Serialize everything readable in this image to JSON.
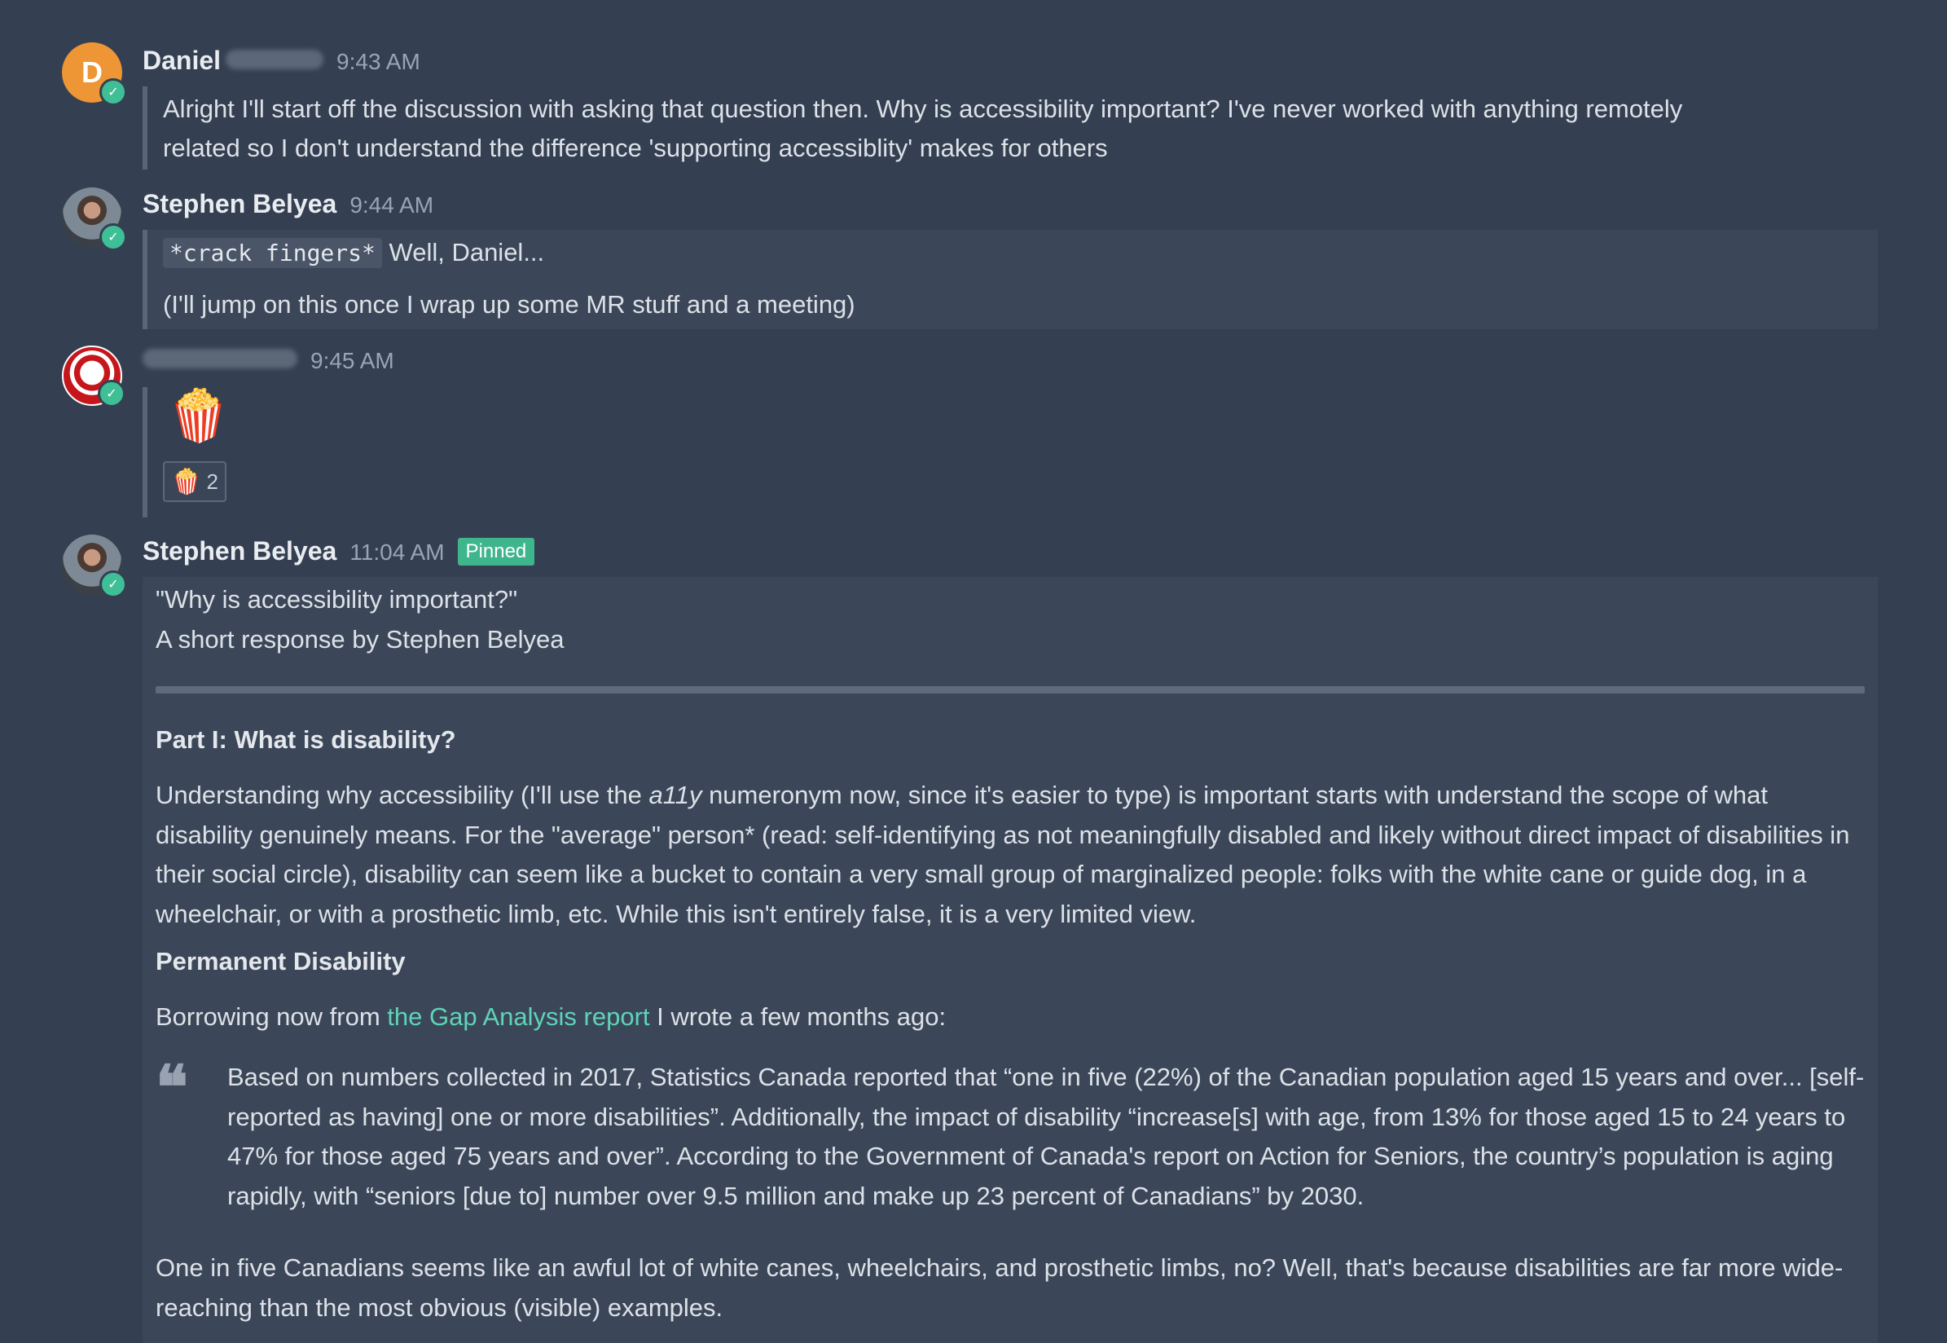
{
  "messages": [
    {
      "author": "Daniel",
      "avatar_initial": "D",
      "time": "9:43 AM",
      "lines": [
        "Alright I'll start off the discussion with asking that question then. Why is accessibility important? I've never worked with anything remotely",
        "related so I don't understand the difference 'supporting accessiblity' makes for others"
      ]
    },
    {
      "author": "Stephen Belyea",
      "time": "9:44 AM",
      "code": "*crack fingers*",
      "line1_rest": "Well, Daniel...",
      "line2": "(I'll jump on this once I wrap up some MR stuff and a meeting)"
    },
    {
      "time": "9:45 AM",
      "emoji": "🍿",
      "reaction": {
        "emoji": "🍿",
        "count": "2"
      }
    },
    {
      "author": "Stephen Belyea",
      "time": "11:04 AM",
      "pinned": "Pinned",
      "title": "\"Why is accessibility important?\"",
      "subtitle": "A short response by Stephen Belyea",
      "part_heading": "Part I: What is disability?",
      "para1_a": "Understanding why accessibility (I'll use the ",
      "para1_em": "a11y",
      "para1_b": " numeronym now, since it's easier to type) is important starts with understand the scope of what disability genuinely means. For the \"average\" person* (read: self-identifying as not meaningfully disabled and likely without direct impact of disabilities in their social circle), disability can seem like a bucket to contain a very small group of marginalized people: folks with the white cane or guide dog, in a wheelchair, or with a prosthetic limb, etc. While this isn't entirely false, it is a very limited view.",
      "subheading": "Permanent Disability",
      "borrow_a": "Borrowing now from ",
      "borrow_link": "the Gap Analysis report",
      "borrow_b": " I wrote a few months ago:",
      "quote": "Based on numbers collected in 2017, Statistics Canada reported that “one in five (22%) of the Canadian population aged 15 years and over... [self-reported as having] one or more disabilities”. Additionally, the impact of disability “increase[s] with age, from 13% for those aged 15 to 24 years to 47% for those aged 75 years and over”. According to the Government of Canada's report on Action for Seniors, the country’s population is aging rapidly, with “seniors [due to] number over 9.5 million and make up 23 percent of Canadians” by 2030.",
      "closing": "One in five Canadians seems like an awful lot of white canes, wheelchairs, and prosthetic limbs, no? Well, that's because disabilities are far more wide-reaching than the most obvious (visible) examples."
    }
  ],
  "icons": {
    "status_check": "✓",
    "quote_mark": "❝"
  },
  "colors": {
    "background": "#344052",
    "accent": "#3fbf96",
    "link": "#5fd3b7",
    "avatar_daniel": "#ee9535"
  }
}
